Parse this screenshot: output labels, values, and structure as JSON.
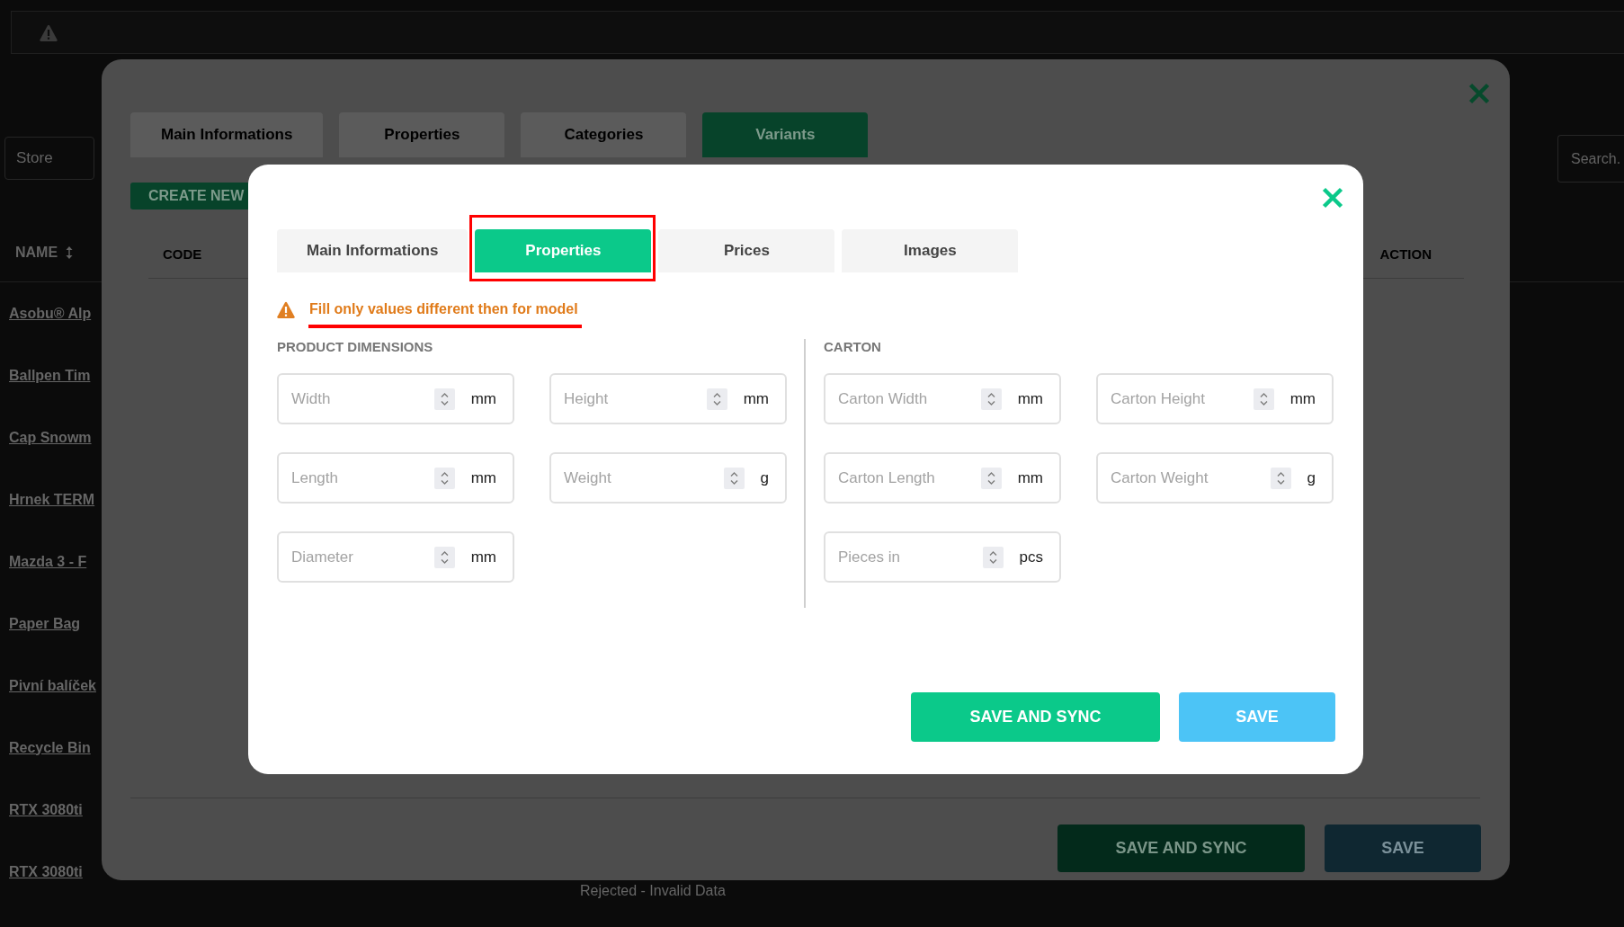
{
  "page": {
    "store_select": {
      "value": "Store"
    },
    "search": {
      "placeholder": "Search."
    },
    "name_column": {
      "label": "NAME"
    },
    "products": [
      {
        "name": "Asobu® Alp"
      },
      {
        "name": "Ballpen Tim"
      },
      {
        "name": "Cap Snowm"
      },
      {
        "name": "Hrnek TERM"
      },
      {
        "name": "Mazda 3 - F"
      },
      {
        "name": "Paper Bag"
      },
      {
        "name": "Pivní balíček"
      },
      {
        "name": "Recycle Bin"
      },
      {
        "name": "RTX 3080ti"
      },
      {
        "name": "RTX 3080ti"
      }
    ],
    "status_text": "Rejected - Invalid Data"
  },
  "variants_dialog": {
    "tabs": [
      {
        "label": "Main Informations",
        "selected": false
      },
      {
        "label": "Properties",
        "selected": false
      },
      {
        "label": "Categories",
        "selected": false
      },
      {
        "label": "Variants",
        "selected": true
      }
    ],
    "create_button": "CREATE NEW",
    "columns": [
      {
        "label": "CODE"
      },
      {
        "label": "ACTION"
      }
    ],
    "buttons": [
      {
        "label": "SAVE AND SYNC",
        "kind": "sync"
      },
      {
        "label": "SAVE",
        "kind": "save"
      }
    ]
  },
  "properties_dialog": {
    "tabs": [
      {
        "label": "Main Informations",
        "selected": false,
        "highlighted": false
      },
      {
        "label": "Properties",
        "selected": true,
        "highlighted": true
      },
      {
        "label": "Prices",
        "selected": false,
        "highlighted": false
      },
      {
        "label": "Images",
        "selected": false,
        "highlighted": false
      }
    ],
    "warning": {
      "text": "Fill only values different then for model",
      "underlined": true
    },
    "sections": [
      {
        "title": "PRODUCT DIMENSIONS",
        "fields": [
          {
            "placeholder": "Width",
            "unit": "mm"
          },
          {
            "placeholder": "Height",
            "unit": "mm"
          },
          {
            "placeholder": "Length",
            "unit": "mm"
          },
          {
            "placeholder": "Weight",
            "unit": "g"
          },
          {
            "placeholder": "Diameter",
            "unit": "mm"
          }
        ]
      },
      {
        "title": "CARTON",
        "fields": [
          {
            "placeholder": "Carton Width",
            "unit": "mm"
          },
          {
            "placeholder": "Carton Height",
            "unit": "mm"
          },
          {
            "placeholder": "Carton Length",
            "unit": "mm"
          },
          {
            "placeholder": "Carton Weight",
            "unit": "g"
          },
          {
            "placeholder": "Pieces in",
            "unit": "pcs"
          }
        ]
      }
    ],
    "buttons": [
      {
        "label": "SAVE AND SYNC",
        "kind": "sync"
      },
      {
        "label": "SAVE",
        "kind": "save"
      }
    ]
  }
}
